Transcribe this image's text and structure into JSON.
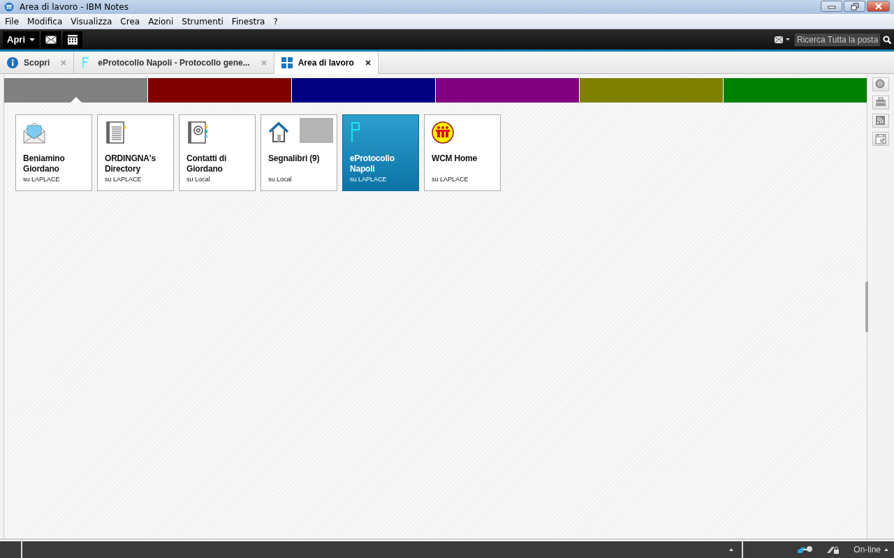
{
  "window": {
    "title": "Area di lavoro - IBM Notes"
  },
  "menu": [
    "File",
    "Modifica",
    "Visualizza",
    "Crea",
    "Azioni",
    "Strumenti",
    "Finestra",
    "?"
  ],
  "toolbar": {
    "open_button": "Apri",
    "search": {
      "placeholder": "Ricerca Tutta la posta"
    }
  },
  "tabs": [
    {
      "label": "Scopri",
      "kind": "info",
      "selected": false
    },
    {
      "label": "eProtocollo Napoli - Protocollo gene...",
      "kind": "protocol",
      "selected": false
    },
    {
      "label": "Area di lavoro",
      "kind": "workspace",
      "selected": true
    }
  ],
  "workspace_pages": [
    {
      "color": "#808080",
      "selected": true
    },
    {
      "color": "#800000",
      "selected": false
    },
    {
      "color": "#000080",
      "selected": false
    },
    {
      "color": "#800080",
      "selected": false
    },
    {
      "color": "#808000",
      "selected": false
    },
    {
      "color": "#008000",
      "selected": false
    }
  ],
  "tiles": [
    {
      "title": "Beniamino Giordano",
      "server": "su LAPLACE",
      "kind": "mail",
      "selected": false
    },
    {
      "title": "ORDINGNA's Directory",
      "server": "su LAPLACE",
      "kind": "directory",
      "selected": false
    },
    {
      "title": "Contatti di Giordano",
      "server": "su Local",
      "kind": "contacts",
      "selected": false
    },
    {
      "title": "Segnalibri (9)",
      "server": "su Local",
      "kind": "bookmarks",
      "selected": false
    },
    {
      "title": "eProtocollo Napoli",
      "server": "su LAPLACE",
      "kind": "protocol",
      "selected": true
    },
    {
      "title": "WCM Home",
      "server": "su LAPLACE",
      "kind": "wcm",
      "selected": false
    }
  ],
  "status_bar": {
    "status": "On-line"
  }
}
